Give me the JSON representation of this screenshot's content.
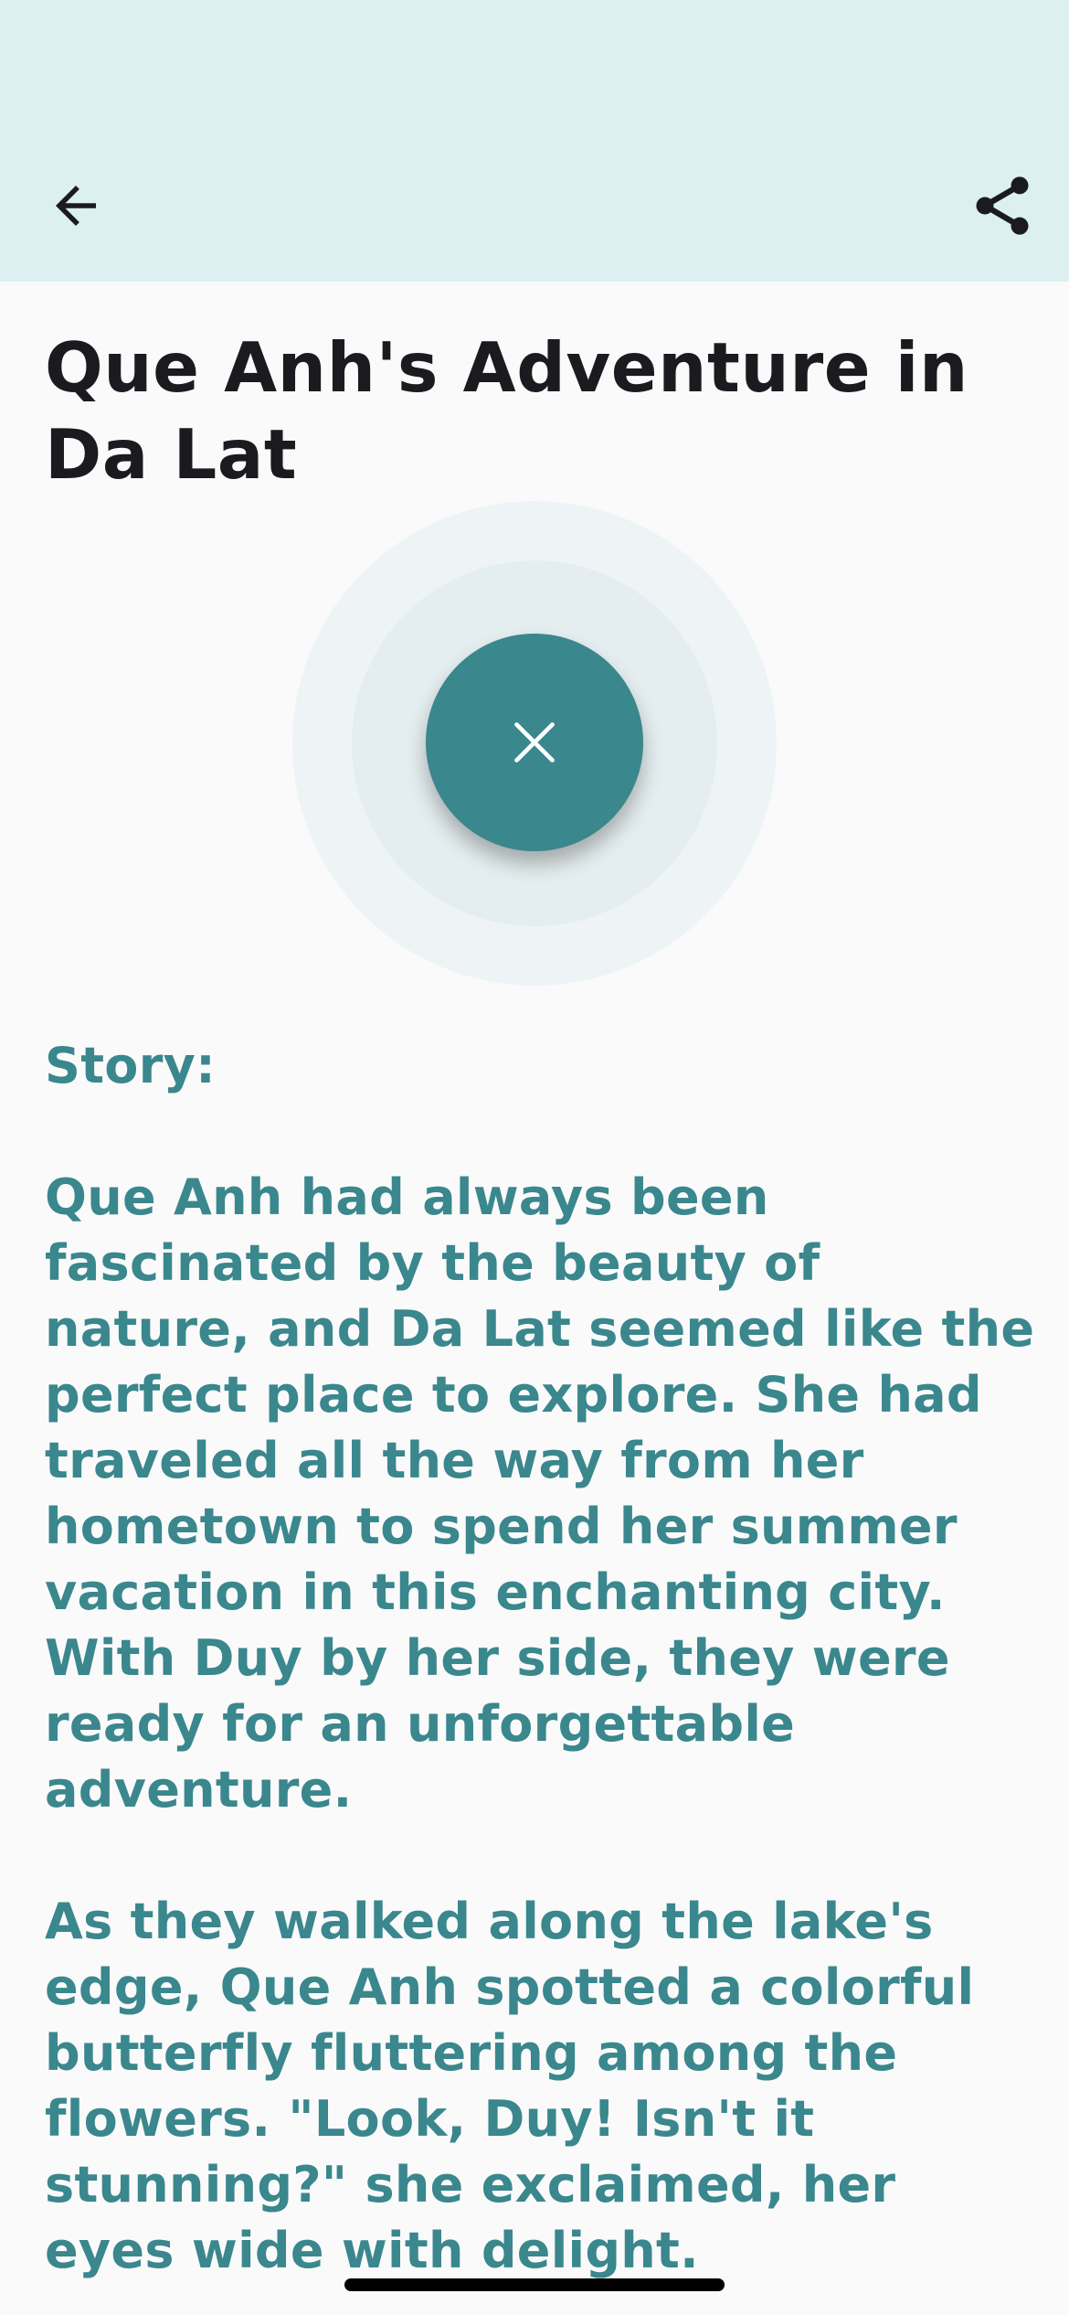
{
  "header": {
    "back_icon": "arrow-left-icon",
    "share_icon": "share-icon",
    "background": "#dcf0f2"
  },
  "title": "Que Anh's Adventure in Da Lat",
  "player": {
    "close_icon": "close-icon",
    "accent": "#3a878d"
  },
  "story": {
    "label": "Story:",
    "paragraphs": [
      "Que Anh had always been fascinated by the beauty of nature, and Da Lat seemed like the perfect place to explore. She had traveled all the way from her hometown to spend her summer vacation in this enchanting city. With Duy by her side, they were ready for an unforgettable adventure.",
      "As they walked along the lake's edge, Que Anh spotted a colorful butterfly fluttering among the flowers. \"Look, Duy! Isn't it stunning?\" she exclaimed, her eyes wide with delight."
    ]
  }
}
